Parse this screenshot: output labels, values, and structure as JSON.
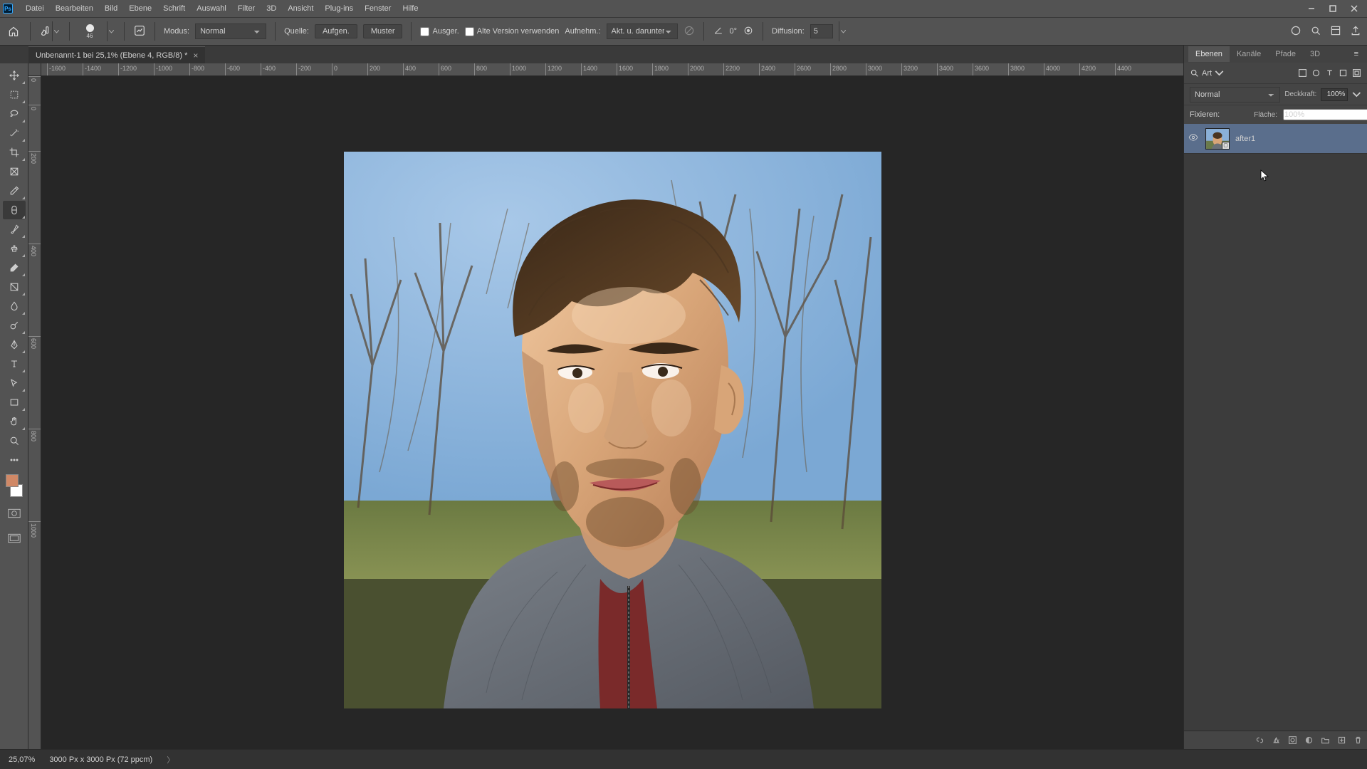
{
  "menu": [
    "Datei",
    "Bearbeiten",
    "Bild",
    "Ebene",
    "Schrift",
    "Auswahl",
    "Filter",
    "3D",
    "Ansicht",
    "Plug-ins",
    "Fenster",
    "Hilfe"
  ],
  "document": {
    "title": "Unbenannt-1 bei 25,1% (Ebene 4, RGB/8) *"
  },
  "options": {
    "brush_size": "46",
    "modus_label": "Modus:",
    "modus_value": "Normal",
    "quelle_label": "Quelle:",
    "aufgen": "Aufgen.",
    "muster": "Muster",
    "ausger": "Ausger.",
    "alte_version": "Alte Version verwenden",
    "aufnehm": "Aufnehm.:",
    "aufnehm_value": "Akt. u. darunter",
    "angle": "0°",
    "diffusion_label": "Diffusion:",
    "diffusion_value": "5"
  },
  "rulers": {
    "h": [
      "-1600",
      "-1400",
      "-1200",
      "-1000",
      "-800",
      "-600",
      "-400",
      "-200",
      "0",
      "200",
      "400",
      "600",
      "800",
      "1000",
      "1200",
      "1400",
      "1600",
      "1800",
      "2000",
      "2200",
      "2400",
      "2600",
      "2800",
      "3000",
      "3200",
      "3400",
      "3600",
      "3800",
      "4000",
      "4200",
      "4400"
    ],
    "v": [
      "0",
      "0",
      "200",
      "400",
      "600",
      "800",
      "1000"
    ]
  },
  "right_panel": {
    "tabs": [
      "Ebenen",
      "Kanäle",
      "Pfade",
      "3D"
    ],
    "search_label": "Art",
    "blend_mode": "Normal",
    "deckkraft_label": "Deckkraft:",
    "deckkraft_value": "100%",
    "fixieren_label": "Fixieren:",
    "flaeche_label": "Fläche:",
    "flaeche_value": "100%",
    "layer_name": "after1"
  },
  "status": {
    "zoom": "25,07%",
    "info": "3000 Px x 3000 Px (72 ppcm)"
  },
  "colors": {
    "fg": "#d08866",
    "bg": "#ffffff"
  }
}
